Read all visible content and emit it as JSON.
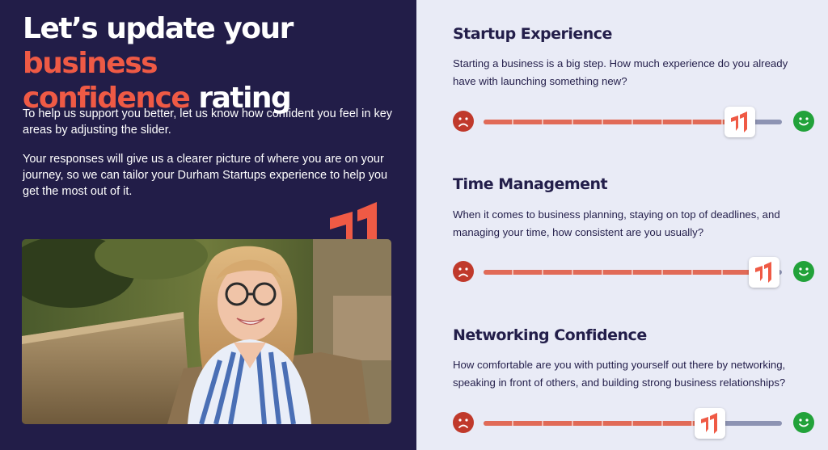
{
  "hero": {
    "headline_part1": "Let’s update your ",
    "headline_accent1": "business",
    "headline_accent2": "confidence",
    "headline_part2": " rating",
    "intro_1": "To help us support you better, let us know how confident you feel in key areas by adjusting the slider.",
    "intro_2": "Your responses will give us a clearer picture of where you are on your journey, so we can tailor your Durham Startups experience to help you get the most out of it."
  },
  "colors": {
    "navy": "#221d48",
    "accent": "#ef5a45",
    "slider_fill": "#e16a57",
    "slider_track": "#8d93b3",
    "sad": "#c0392b",
    "happy": "#22a23a",
    "panel_bg": "#e9ebf6"
  },
  "questions": [
    {
      "title": "Startup Experience",
      "description": "Starting a business is a big step. How much experience do you already have with launching something new?",
      "value": 0.86,
      "left_icon": "sad-face-icon",
      "right_icon": "happy-face-icon"
    },
    {
      "title": "Time Management",
      "description": "When it comes to business planning, staying on top of deadlines, and managing your time, how consistent are you usually?",
      "value": 0.94,
      "left_icon": "sad-face-icon",
      "right_icon": "happy-face-icon"
    },
    {
      "title": "Networking Confidence",
      "description": "How comfortable are you with putting yourself out there by networking, speaking in front of others, and building strong business relationships?",
      "value": 0.76,
      "left_icon": "sad-face-icon",
      "right_icon": "happy-face-icon"
    }
  ]
}
